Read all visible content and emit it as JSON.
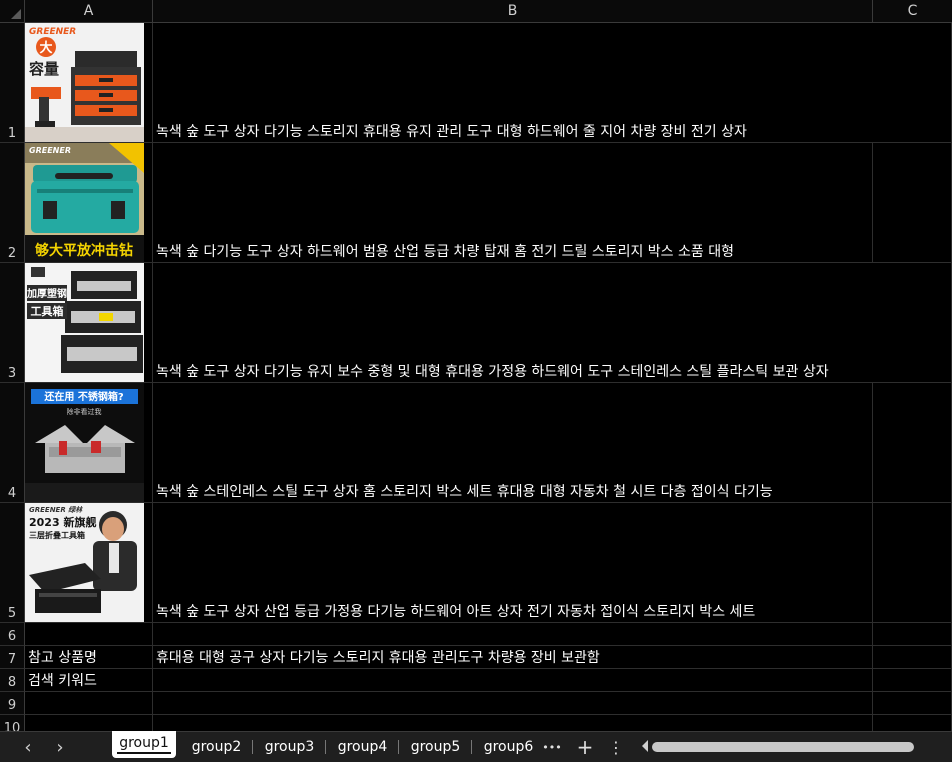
{
  "columns": [
    "A",
    "B",
    "C"
  ],
  "rows": [
    "1",
    "2",
    "3",
    "4",
    "5",
    "6",
    "7",
    "8",
    "9",
    "10"
  ],
  "products": [
    {
      "title": "녹색 숲 도구 상자 다기능 스토리지 휴대용 유지 관리 도구 대형 하드웨어 줄 지어 차량 장비 전기 상자",
      "img_text_1": "GREENER",
      "img_text_2": "大",
      "img_text_3": "容量"
    },
    {
      "title": "녹색 숲 다기능 도구 상자 하드웨어 범용 산업 등급 차량 탑재 홈 전기 드릴 스토리지 박스 소품 대형",
      "img_text_1": "GREENER",
      "img_text_2": "够大平放冲击钻"
    },
    {
      "title": "녹색 숲 도구 상자 다기능 유지 보수 중형 및 대형 휴대용 가정용 하드웨어 도구 스테인레스 스틸 플라스틱 보관 상자",
      "img_text_1": "加厚塑钢",
      "img_text_2": "工具箱"
    },
    {
      "title": "녹색 숲 스테인레스 스틸 도구 상자 홈 스토리지 박스 세트 휴대용 대형 자동차 철 시트 다층 접이식 다기능",
      "img_text_1": "还在用 不锈钢箱?",
      "img_text_2": "除非看过我"
    },
    {
      "title": "녹색 숲 도구 상자 산업 등급 가정용 다기능 하드웨어 아트 상자 전기 자동차 접이식 스토리지 박스 세트",
      "img_text_1": "GREENER 绿林",
      "img_text_2": "2023 新旗舰",
      "img_text_3": "三层折叠工具箱"
    }
  ],
  "row7": {
    "label": "참고 상품명",
    "value": "휴대용 대형 공구 상자 다기능 스토리지 휴대용 관리도구 차량용 장비 보관함"
  },
  "row8": {
    "label": "검색 키워드"
  },
  "tabs": [
    "group1",
    "group2",
    "group3",
    "group4",
    "group5",
    "group6"
  ],
  "active_tab": "group1",
  "toolbar": {
    "more": "•••",
    "add": "+",
    "menu": "⋮",
    "prev": "‹",
    "next": "›"
  },
  "colors": {
    "background": "#000000",
    "gridline": "#2e2e2e",
    "header_text": "#d0d0d0",
    "active_tab_bg": "#ffffff"
  }
}
